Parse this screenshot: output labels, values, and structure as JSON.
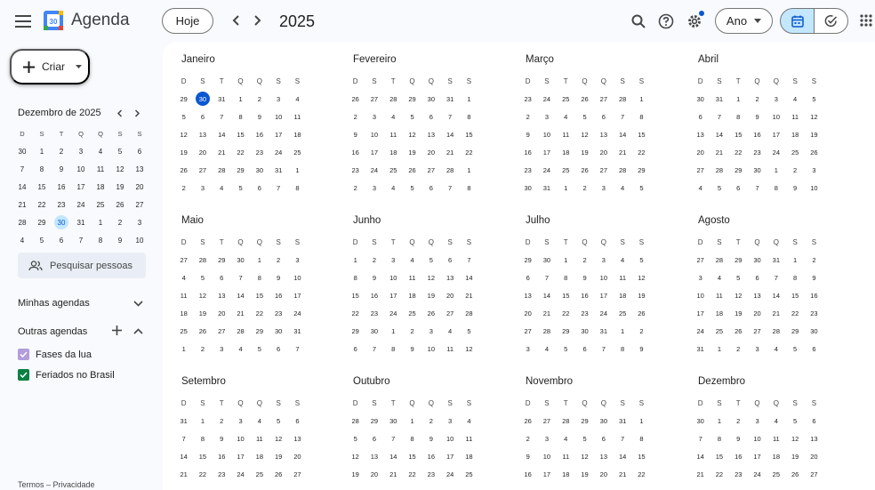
{
  "header": {
    "app_title": "Agenda",
    "logo_number": "30",
    "today_label": "Hoje",
    "year_title": "2025",
    "view_label": "Ano"
  },
  "sidebar": {
    "create_label": "Criar",
    "mini_title": "Dezembro de 2025",
    "weekdays": [
      "D",
      "S",
      "T",
      "Q",
      "Q",
      "S",
      "S"
    ],
    "mini_weeks": [
      [
        "30",
        "1",
        "2",
        "3",
        "4",
        "5",
        "6"
      ],
      [
        "7",
        "8",
        "9",
        "10",
        "11",
        "12",
        "13"
      ],
      [
        "14",
        "15",
        "16",
        "17",
        "18",
        "19",
        "20"
      ],
      [
        "21",
        "22",
        "23",
        "24",
        "25",
        "26",
        "27"
      ],
      [
        "28",
        "29",
        "30",
        "31",
        "1",
        "2",
        "3"
      ],
      [
        "4",
        "5",
        "6",
        "7",
        "8",
        "9",
        "10"
      ]
    ],
    "mini_selected": "30",
    "search_people_placeholder": "Pesquisar pessoas",
    "my_calendars_label": "Minhas agendas",
    "other_calendars_label": "Outras agendas",
    "calendars": [
      {
        "name": "Fases da lua",
        "color": "#b39ddb"
      },
      {
        "name": "Feriados no Brasil",
        "color": "#0b8043"
      }
    ],
    "footer": "Termos – Privacidade"
  },
  "year_view": {
    "weekdays": [
      "D",
      "S",
      "T",
      "Q",
      "Q",
      "S",
      "S"
    ],
    "today_month": 0,
    "today_day": "30",
    "months": [
      {
        "name": "Janeiro",
        "weeks": [
          [
            "29",
            "30",
            "31",
            "1",
            "2",
            "3",
            "4"
          ],
          [
            "5",
            "6",
            "7",
            "8",
            "9",
            "10",
            "11"
          ],
          [
            "12",
            "13",
            "14",
            "15",
            "16",
            "17",
            "18"
          ],
          [
            "19",
            "20",
            "21",
            "22",
            "23",
            "24",
            "25"
          ],
          [
            "26",
            "27",
            "28",
            "29",
            "30",
            "31",
            "1"
          ],
          [
            "2",
            "3",
            "4",
            "5",
            "6",
            "7",
            "8"
          ]
        ]
      },
      {
        "name": "Fevereiro",
        "weeks": [
          [
            "26",
            "27",
            "28",
            "29",
            "30",
            "31",
            "1"
          ],
          [
            "2",
            "3",
            "4",
            "5",
            "6",
            "7",
            "8"
          ],
          [
            "9",
            "10",
            "11",
            "12",
            "13",
            "14",
            "15"
          ],
          [
            "16",
            "17",
            "18",
            "19",
            "20",
            "21",
            "22"
          ],
          [
            "23",
            "24",
            "25",
            "26",
            "27",
            "28",
            "1"
          ],
          [
            "2",
            "3",
            "4",
            "5",
            "6",
            "7",
            "8"
          ]
        ]
      },
      {
        "name": "Março",
        "weeks": [
          [
            "23",
            "24",
            "25",
            "26",
            "27",
            "28",
            "1"
          ],
          [
            "2",
            "3",
            "4",
            "5",
            "6",
            "7",
            "8"
          ],
          [
            "9",
            "10",
            "11",
            "12",
            "13",
            "14",
            "15"
          ],
          [
            "16",
            "17",
            "18",
            "19",
            "20",
            "21",
            "22"
          ],
          [
            "23",
            "24",
            "25",
            "26",
            "27",
            "28",
            "29"
          ],
          [
            "30",
            "31",
            "1",
            "2",
            "3",
            "4",
            "5"
          ]
        ]
      },
      {
        "name": "Abril",
        "weeks": [
          [
            "30",
            "31",
            "1",
            "2",
            "3",
            "4",
            "5"
          ],
          [
            "6",
            "7",
            "8",
            "9",
            "10",
            "11",
            "12"
          ],
          [
            "13",
            "14",
            "15",
            "16",
            "17",
            "18",
            "19"
          ],
          [
            "20",
            "21",
            "22",
            "23",
            "24",
            "25",
            "26"
          ],
          [
            "27",
            "28",
            "29",
            "30",
            "1",
            "2",
            "3"
          ],
          [
            "4",
            "5",
            "6",
            "7",
            "8",
            "9",
            "10"
          ]
        ]
      },
      {
        "name": "Maio",
        "weeks": [
          [
            "27",
            "28",
            "29",
            "30",
            "1",
            "2",
            "3"
          ],
          [
            "4",
            "5",
            "6",
            "7",
            "8",
            "9",
            "10"
          ],
          [
            "11",
            "12",
            "13",
            "14",
            "15",
            "16",
            "17"
          ],
          [
            "18",
            "19",
            "20",
            "21",
            "22",
            "23",
            "24"
          ],
          [
            "25",
            "26",
            "27",
            "28",
            "29",
            "30",
            "31"
          ],
          [
            "1",
            "2",
            "3",
            "4",
            "5",
            "6",
            "7"
          ]
        ]
      },
      {
        "name": "Junho",
        "weeks": [
          [
            "1",
            "2",
            "3",
            "4",
            "5",
            "6",
            "7"
          ],
          [
            "8",
            "9",
            "10",
            "11",
            "12",
            "13",
            "14"
          ],
          [
            "15",
            "16",
            "17",
            "18",
            "19",
            "20",
            "21"
          ],
          [
            "22",
            "23",
            "24",
            "25",
            "26",
            "27",
            "28"
          ],
          [
            "29",
            "30",
            "1",
            "2",
            "3",
            "4",
            "5"
          ],
          [
            "6",
            "7",
            "8",
            "9",
            "10",
            "11",
            "12"
          ]
        ]
      },
      {
        "name": "Julho",
        "weeks": [
          [
            "29",
            "30",
            "1",
            "2",
            "3",
            "4",
            "5"
          ],
          [
            "6",
            "7",
            "8",
            "9",
            "10",
            "11",
            "12"
          ],
          [
            "13",
            "14",
            "15",
            "16",
            "17",
            "18",
            "19"
          ],
          [
            "20",
            "21",
            "22",
            "23",
            "24",
            "25",
            "26"
          ],
          [
            "27",
            "28",
            "29",
            "30",
            "31",
            "1",
            "2"
          ],
          [
            "3",
            "4",
            "5",
            "6",
            "7",
            "8",
            "9"
          ]
        ]
      },
      {
        "name": "Agosto",
        "weeks": [
          [
            "27",
            "28",
            "29",
            "30",
            "31",
            "1",
            "2"
          ],
          [
            "3",
            "4",
            "5",
            "6",
            "7",
            "8",
            "9"
          ],
          [
            "10",
            "11",
            "12",
            "13",
            "14",
            "15",
            "16"
          ],
          [
            "17",
            "18",
            "19",
            "20",
            "21",
            "22",
            "23"
          ],
          [
            "24",
            "25",
            "26",
            "27",
            "28",
            "29",
            "30"
          ],
          [
            "31",
            "1",
            "2",
            "3",
            "4",
            "5",
            "6"
          ]
        ]
      },
      {
        "name": "Setembro",
        "weeks": [
          [
            "31",
            "1",
            "2",
            "3",
            "4",
            "5",
            "6"
          ],
          [
            "7",
            "8",
            "9",
            "10",
            "11",
            "12",
            "13"
          ],
          [
            "14",
            "15",
            "16",
            "17",
            "18",
            "19",
            "20"
          ],
          [
            "21",
            "22",
            "23",
            "24",
            "25",
            "26",
            "27"
          ]
        ]
      },
      {
        "name": "Outubro",
        "weeks": [
          [
            "28",
            "29",
            "30",
            "1",
            "2",
            "3",
            "4"
          ],
          [
            "5",
            "6",
            "7",
            "8",
            "9",
            "10",
            "11"
          ],
          [
            "12",
            "13",
            "14",
            "15",
            "16",
            "17",
            "18"
          ],
          [
            "19",
            "20",
            "21",
            "22",
            "23",
            "24",
            "25"
          ]
        ]
      },
      {
        "name": "Novembro",
        "weeks": [
          [
            "26",
            "27",
            "28",
            "29",
            "30",
            "31",
            "1"
          ],
          [
            "2",
            "3",
            "4",
            "5",
            "6",
            "7",
            "8"
          ],
          [
            "9",
            "10",
            "11",
            "12",
            "13",
            "14",
            "15"
          ],
          [
            "16",
            "17",
            "18",
            "19",
            "20",
            "21",
            "22"
          ]
        ]
      },
      {
        "name": "Dezembro",
        "weeks": [
          [
            "30",
            "1",
            "2",
            "3",
            "4",
            "5",
            "6"
          ],
          [
            "7",
            "8",
            "9",
            "10",
            "11",
            "12",
            "13"
          ],
          [
            "14",
            "15",
            "16",
            "17",
            "18",
            "19",
            "20"
          ],
          [
            "21",
            "22",
            "23",
            "24",
            "25",
            "26",
            "27"
          ]
        ]
      }
    ]
  }
}
